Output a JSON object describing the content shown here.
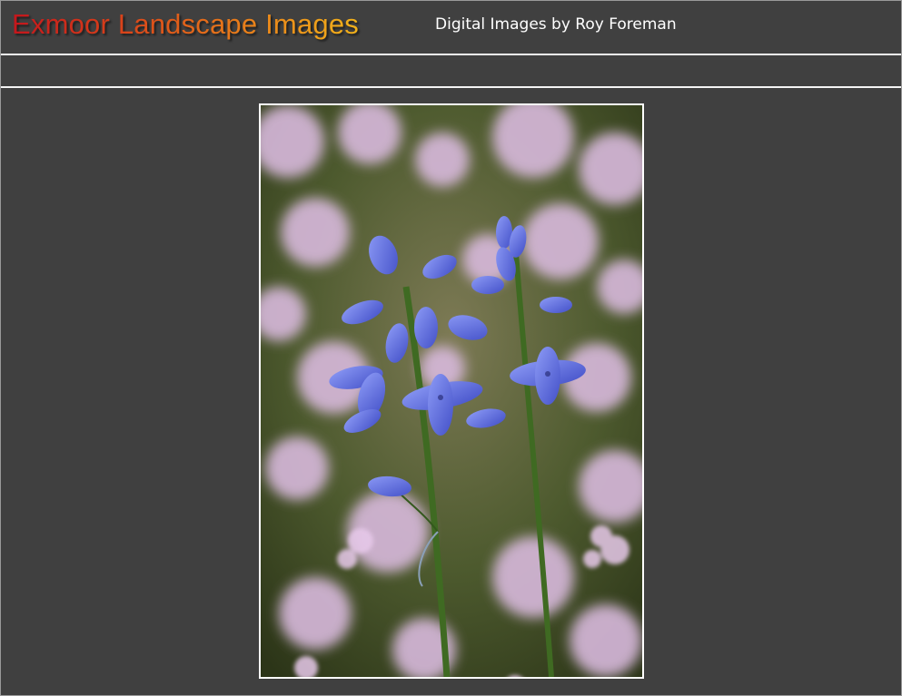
{
  "header": {
    "title": "Exmoor Landscape Images",
    "subtitle": "Digital Images by Roy Foreman"
  },
  "photo": {
    "subject": "bluebell-flowers",
    "alt": ""
  },
  "colors": {
    "background": "#404040",
    "rule": "#f4f4f4",
    "title_gradient_start": "#c4161c",
    "title_gradient_end": "#f2b21a",
    "bluebell": "#5b6be0"
  }
}
